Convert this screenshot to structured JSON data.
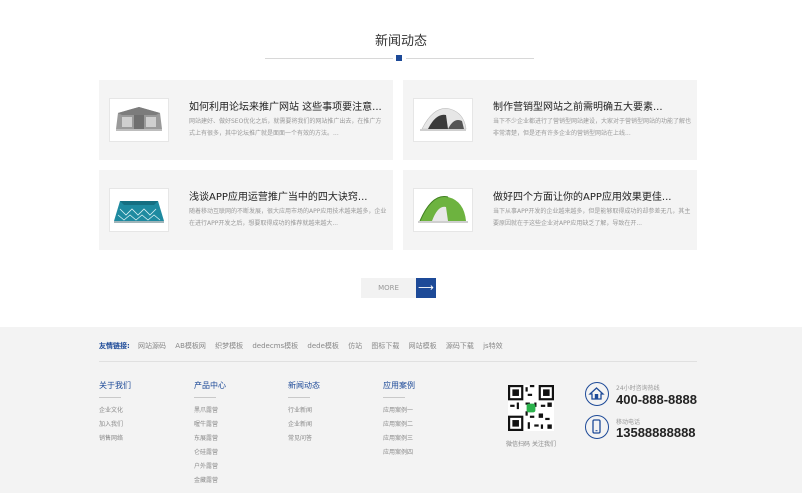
{
  "news": {
    "title": "新闻动态",
    "items": [
      {
        "title": "如何利用论坛来推广网站 这些事项要注意...",
        "desc": "网站建好、做好SEO优化之后，就需要将我们的网站推广出去，在推广方式上有很多，其中论坛推广就是面面一个有效的方法。..."
      },
      {
        "title": "制作营销型网站之前需明确五大要素...",
        "desc": "当下不少企业都进行了营销型网站建设，大家对于营销型网站的功能了解也非常清楚，但是还有许多企业的营销型网站在上线..."
      },
      {
        "title": "浅谈APP应用运营推广当中的四大诀窍...",
        "desc": "随着移动互联网的不断发展，很大应用市场的APP应用技术越来越多，企业在进行APP开发之后，想要取得成功的推荐就越来越大..."
      },
      {
        "title": "做好四个方面让你的APP应用效果更佳...",
        "desc": "当下从事APP开发的企业越来越多，但是能够取得成功的却参差无几，其主要原因就在于这些企业对APP应用缺乏了解，导致在开..."
      }
    ],
    "more_label": "MORE",
    "more_arrow": "⟶"
  },
  "footer": {
    "links_label": "友情链接:",
    "links": [
      "网站源码",
      "AB模板网",
      "织梦模板",
      "dedecms模板",
      "dede模板",
      "仿站",
      "图标下载",
      "网站模板",
      "源码下载",
      "js特效"
    ],
    "columns": [
      {
        "title": "关于我们",
        "items": [
          "企业文化",
          "加入我们",
          "销售网络"
        ]
      },
      {
        "title": "产品中心",
        "items": [
          "黑爪露营",
          "喔牛露营",
          "东展露营",
          "仑硅露营",
          "户外露营",
          "金藏露营"
        ]
      },
      {
        "title": "新闻动态",
        "items": [
          "行业新闻",
          "企业新闻",
          "常见问答"
        ]
      },
      {
        "title": "应用案例",
        "items": [
          "应用案例一",
          "应用案例二",
          "应用案例三",
          "应用案例四"
        ]
      }
    ],
    "qr_caption": "微信扫码 关注我们",
    "hotline_label": "24小时咨询热线",
    "hotline": "400-888-8888",
    "mobile_label": "移动电话",
    "mobile": "13588888888"
  },
  "colors": {
    "accent": "#1d4a98",
    "footer_bg": "#f3f3f3",
    "card_bg": "#f4f4f4"
  },
  "icons": {
    "more": "arrow-right-icon",
    "hotline": "phone-house-icon",
    "mobile": "mobile-phone-icon"
  }
}
